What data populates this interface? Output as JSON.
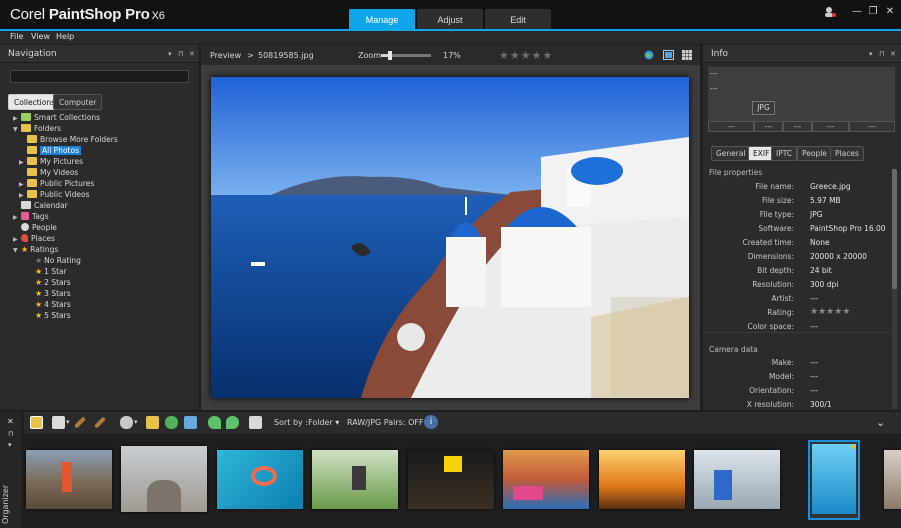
{
  "app": {
    "brand_corel": "Corel",
    "brand_product": "PaintShop Pro",
    "brand_version": "X6",
    "tabs": [
      "Manage",
      "Adjust",
      "Edit"
    ],
    "accent": "#0fa5e9"
  },
  "menu": [
    "File",
    "View",
    "Help"
  ],
  "navigation": {
    "title": "Navigation",
    "tabs": [
      "Collections",
      "Computer"
    ],
    "tree": {
      "smart_collections": "Smart Collections",
      "folders": "Folders",
      "browse_more": "Browse More Folders",
      "all_photos": "All Photos",
      "my_pictures": "My Pictures",
      "my_videos": "My Videos",
      "public_pictures": "Public Pictures",
      "public_videos": "Public Videos",
      "calendar": "Calendar",
      "tags": "Tags",
      "people": "People",
      "places": "Places",
      "ratings": "Ratings",
      "no_rating": "No Rating",
      "star1": "1 Star",
      "star2": "2 Stars",
      "star3": "3 Stars",
      "star4": "4 Stars",
      "star5": "5 Stars"
    }
  },
  "preview": {
    "label": "Preview",
    "sep": ">",
    "filename": "50819585.jpg",
    "zoom_label": "Zoom",
    "zoom_value": "17%",
    "zoom_fraction": 0.17,
    "rating": 0
  },
  "info": {
    "title": "Info",
    "dash1": "---",
    "dash2": "---",
    "format_badge": "JPG",
    "boxes": [
      "---",
      "---",
      "---",
      "---",
      "---"
    ],
    "tabs": [
      "General",
      "EXIF",
      "IPTC",
      "People",
      "Places"
    ],
    "file_properties_title": "File properties",
    "file_props": [
      {
        "label": "File name:",
        "value": "Greece.jpg"
      },
      {
        "label": "File size:",
        "value": "5.97 MB"
      },
      {
        "label": "File type:",
        "value": "JPG"
      },
      {
        "label": "Software:",
        "value": "PaintShop Pro 16.00"
      },
      {
        "label": "Created time:",
        "value": "None"
      },
      {
        "label": "Dimensions:",
        "value": "20000 x 20000"
      },
      {
        "label": "Bit depth:",
        "value": "24 bit"
      },
      {
        "label": "Resolution:",
        "value": "300 dpi"
      },
      {
        "label": "Artist:",
        "value": "---"
      },
      {
        "label": "Rating:",
        "value": ""
      },
      {
        "label": "Color space:",
        "value": "---"
      }
    ],
    "camera_data_title": "Camera data",
    "camera_props": [
      {
        "label": "Make:",
        "value": "---"
      },
      {
        "label": "Model:",
        "value": "---"
      },
      {
        "label": "Orientation:",
        "value": "---"
      },
      {
        "label": "X resolution:",
        "value": "300/1"
      }
    ]
  },
  "organizer": {
    "side_label": "Organizer",
    "sort_label": "Sort by :",
    "sort_value": "Folder",
    "raw_label": "RAW/JPG Pairs: OFF"
  }
}
